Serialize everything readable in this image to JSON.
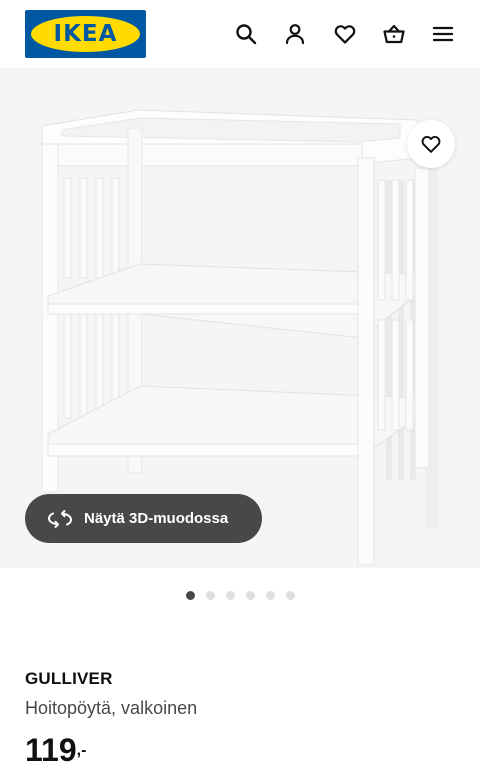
{
  "header": {
    "logo_text": "IKEA",
    "icons": [
      "search-icon",
      "account-icon",
      "heart-icon",
      "basket-icon",
      "menu-icon"
    ]
  },
  "gallery": {
    "view3d_label": "Näytä 3D-muodossa",
    "image_count": 6,
    "active_index": 0
  },
  "product": {
    "name": "GULLIVER",
    "description": "Hoitopöytä, valkoinen",
    "price_integer": "119",
    "price_decimal": ",-"
  },
  "colors": {
    "ikea_blue": "#0058a3",
    "ikea_yellow": "#ffdb00",
    "pill_dark": "#484848",
    "dot_inactive": "#dfdfdf"
  }
}
